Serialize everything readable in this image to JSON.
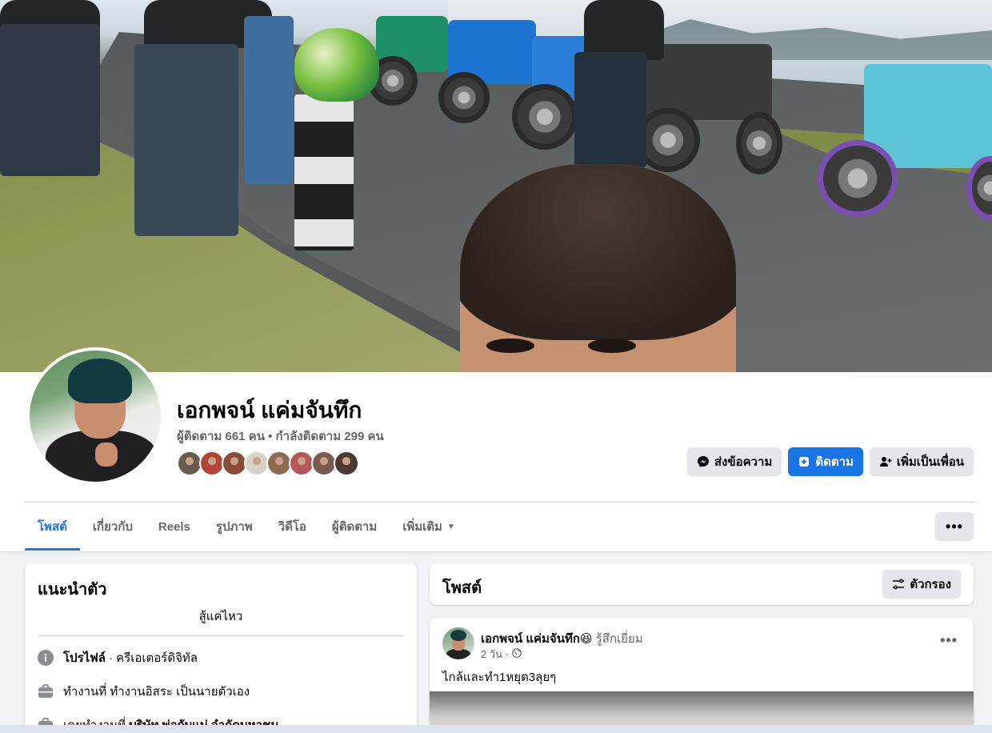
{
  "profile": {
    "name": "เอกพจน์ แค่มจันทึก",
    "followers_text": "ผู้ติดตาม 661 คน • กำลังติดตาม 299 คน",
    "friend_avatar_colors": [
      "#6b5a4e",
      "#b0463a",
      "#8a4a3a",
      "#d9d2c6",
      "#8d6a52",
      "#b5585a",
      "#7a5a50",
      "#4a3a32"
    ]
  },
  "actions": {
    "message_label": "ส่งข้อความ",
    "follow_label": "ติดตาม",
    "add_friend_label": "เพิ่มเป็นเพื่อน"
  },
  "tabs": [
    {
      "label": "โพสต์",
      "active": true
    },
    {
      "label": "เกี่ยวกับ"
    },
    {
      "label": "Reels"
    },
    {
      "label": "รูปภาพ"
    },
    {
      "label": "วิดีโอ"
    },
    {
      "label": "ผู้ติดตาม"
    },
    {
      "label": "เพิ่มเติม"
    }
  ],
  "more_label": "•••",
  "intro": {
    "title": "แนะนำตัว",
    "bio": "สู้แค่ไหว",
    "rows": [
      {
        "bold": "โปรไฟล์",
        "text": "· ครีเอเตอร์ดิจิทัล",
        "icon": "info-icon"
      },
      {
        "bold": "",
        "text": "ทำงานที่ ทำงานอิสระ เป็นนายตัวเอง",
        "icon": "briefcase-icon"
      },
      {
        "bold": "บริษัท พ่อกับแม่ จำกัดมหาชน",
        "text": "เคยทำงานที่",
        "icon": "briefcase-icon"
      }
    ]
  },
  "posts": {
    "title": "โพสต์",
    "filter_label": "ตัวกรอง"
  },
  "post": {
    "author": "เอกพจน์ แค่มจันทึก",
    "emoji": "😆",
    "feeling": " รู้สึกเยี่ยม",
    "time": "2 วัน ·",
    "text": "ไกล้และทำ1หยุด3ลุยๆ"
  },
  "colors": {
    "accent": "#1b74e4",
    "secondary_text": "#65676b",
    "button_gray": "#e4e6eb"
  }
}
